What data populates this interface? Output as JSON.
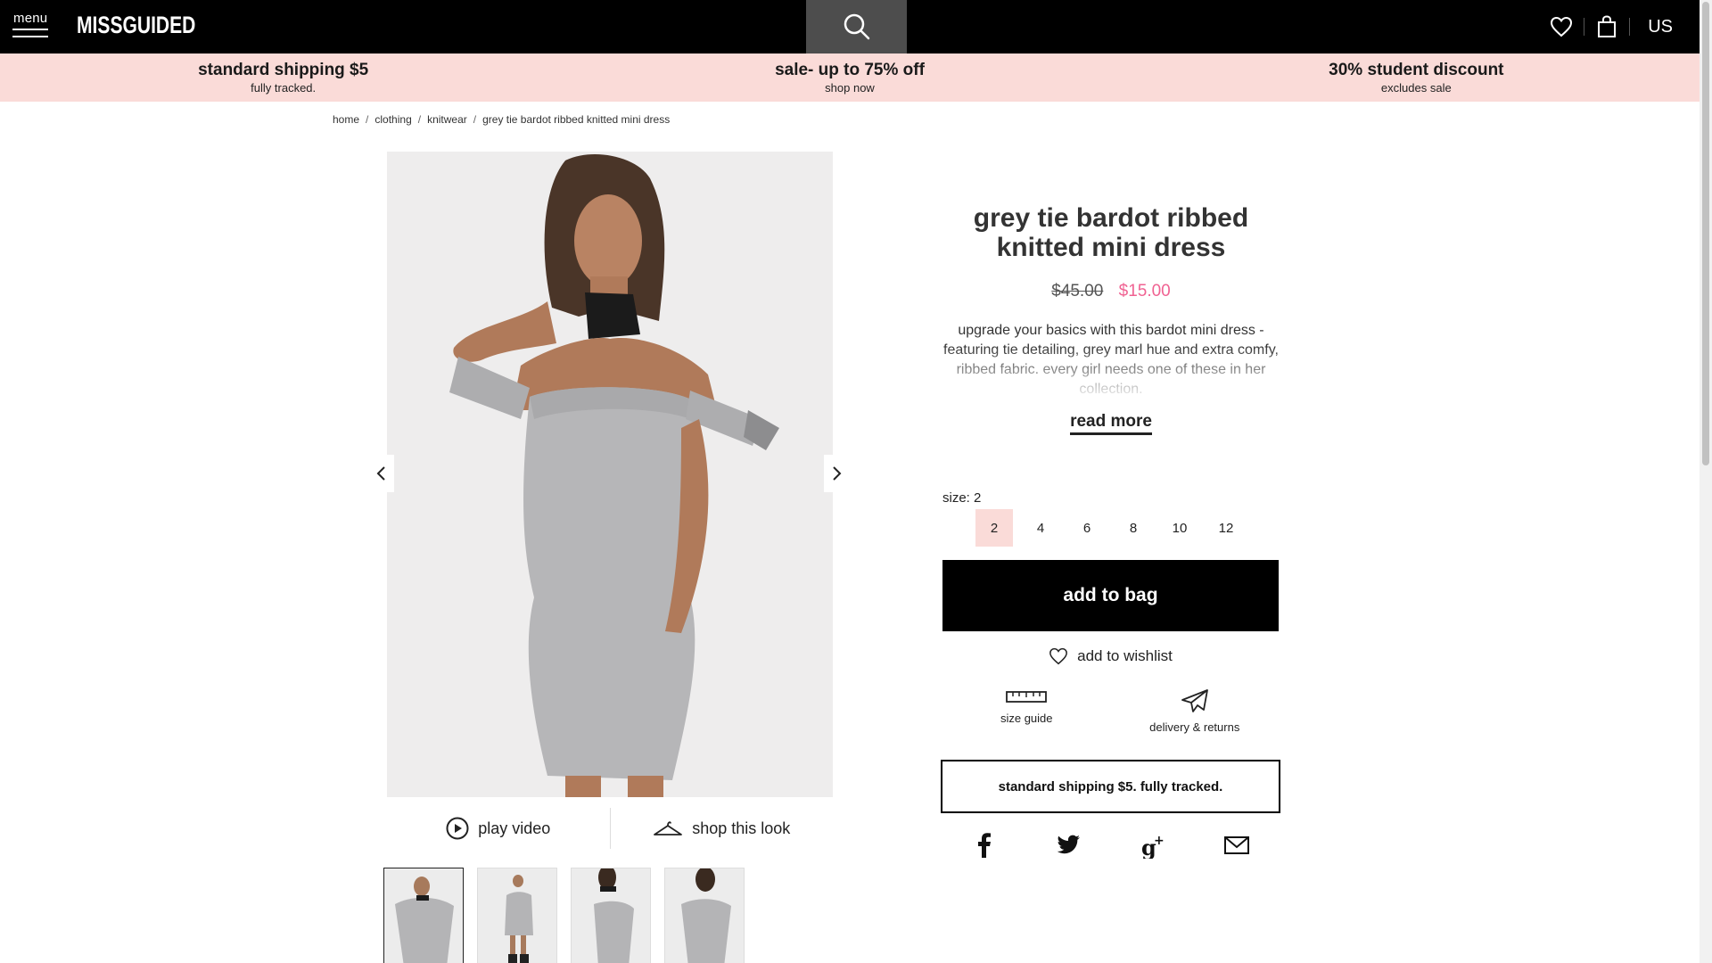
{
  "header": {
    "menu_label": "menu",
    "logo": "MISSGUIDED",
    "country": "US"
  },
  "promos": [
    {
      "title": "standard shipping $5",
      "sub": "fully tracked."
    },
    {
      "title": "sale- up to 75% off",
      "sub": "shop now"
    },
    {
      "title": "30% student discount",
      "sub": "excludes sale"
    }
  ],
  "breadcrumb": [
    "home",
    "clothing",
    "knitwear",
    "grey tie bardot ribbed knitted mini dress"
  ],
  "product": {
    "title": "grey tie bardot ribbed knitted mini dress",
    "old_price": "$45.00",
    "new_price": "$15.00",
    "description": "upgrade your basics with this bardot mini dress - featuring tie detailing, grey marl hue and extra comfy, ribbed fabric. every girl needs one of these in her collection.",
    "read_more": "read more",
    "size_label": "size: 2",
    "sizes": [
      "2",
      "4",
      "6",
      "8",
      "10",
      "12"
    ],
    "selected_size": "2",
    "add_to_bag": "add to bag",
    "add_to_wishlist": "add to wishlist",
    "size_guide": "size guide",
    "delivery_returns": "delivery & returns",
    "shipping_note": "standard shipping $5. fully tracked."
  },
  "media": {
    "play_video": "play video",
    "shop_look": "shop this look"
  },
  "colors": {
    "header_bg": "#000000",
    "promo_bg": "#fadbd8",
    "sale_price": "#f06292",
    "selected_size_bg": "#fadbd8"
  }
}
